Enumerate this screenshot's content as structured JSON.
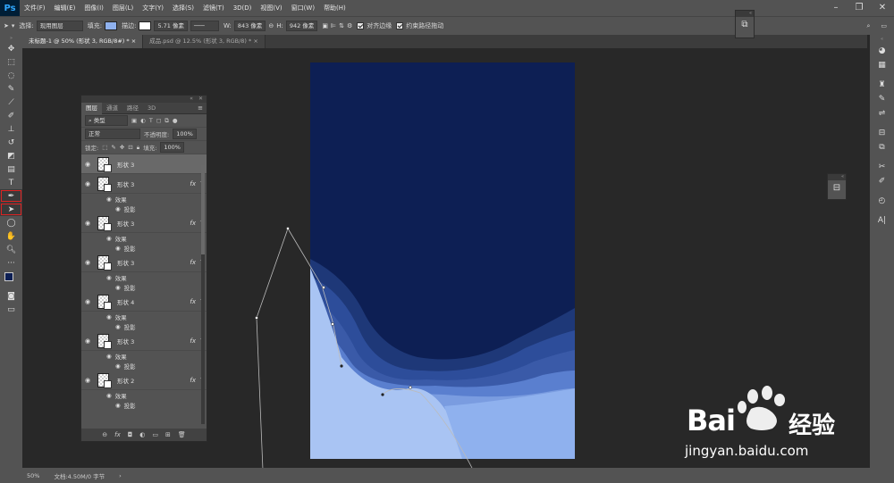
{
  "app": {
    "logo": "Ps"
  },
  "menu": [
    "文件(F)",
    "编辑(E)",
    "图像(I)",
    "图层(L)",
    "文字(Y)",
    "选择(S)",
    "滤镜(T)",
    "3D(D)",
    "视图(V)",
    "窗口(W)",
    "帮助(H)"
  ],
  "options": {
    "select_label": "选择:",
    "select_value": "现用图层",
    "fill_label": "填充:",
    "stroke_label": "描边:",
    "stroke_width": "5.71 像素",
    "w_label": "W:",
    "w_value": "843 像素",
    "h_label": "H:",
    "h_value": "942 像素",
    "align_edges": "对齐边缘",
    "constrain_path": "约束路径拖动",
    "fill_color": "#8fb1ee"
  },
  "tabs": [
    {
      "label": "未标题-1 @ 50% (形状 3, RGB/8#) *",
      "close": "×"
    },
    {
      "label": "成品.psd @ 12.5% (形状 3, RGB/8) *",
      "close": "×"
    }
  ],
  "layers_panel": {
    "tabs": [
      "图层",
      "通道",
      "路径",
      "3D"
    ],
    "filter": "类型",
    "blend_mode": "正常",
    "opacity_label": "不透明度:",
    "opacity": "100%",
    "lock_label": "锁定:",
    "fill_label": "填充:",
    "fill": "100%",
    "layers": [
      {
        "name": "形状 3",
        "fx": false,
        "active": true
      },
      {
        "name": "形状 3",
        "fx": true,
        "effects": "效果",
        "shadow": "投影"
      },
      {
        "name": "形状 3",
        "fx": true,
        "effects": "效果",
        "shadow": "投影"
      },
      {
        "name": "形状 3",
        "fx": true,
        "effects": "效果",
        "shadow": "投影"
      },
      {
        "name": "形状 4",
        "fx": true,
        "effects": "效果",
        "shadow": "投影"
      },
      {
        "name": "形状 3",
        "fx": true,
        "effects": "效果",
        "shadow": "投影"
      },
      {
        "name": "形状 2",
        "fx": true,
        "effects": "效果",
        "shadow": "投影"
      }
    ],
    "fx_label": "fx"
  },
  "status": {
    "zoom": "50%",
    "doc": "文档:4.50M/0 字节"
  },
  "watermark": {
    "brand": "Bai",
    "brand2": "经验",
    "url": "jingyan.baidu.com"
  },
  "colors": {
    "doc_bg": "#0d1f54",
    "wave_light": "#8fb1ee",
    "wave_mid": "#5a7fcf",
    "wave_dark": "#3a5aa8"
  }
}
